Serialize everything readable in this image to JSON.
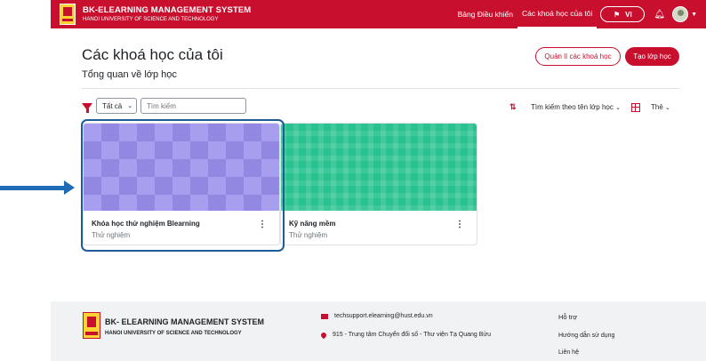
{
  "header": {
    "brand_title": "BK-ELEARNING MANAGEMENT SYSTEM",
    "brand_sub": "HANOI UNIVERSITY OF SCIENCE AND TECHNOLOGY",
    "nav": [
      "Bảng Điều khiển",
      "Các khoá học của tôi"
    ],
    "lang": "VI",
    "colors": {
      "primary": "#c8102e"
    }
  },
  "main": {
    "title": "Các khoá học của tôi",
    "subtitle": "Tổng quan về lớp học",
    "manage_button": "Quản lí các khoá học",
    "create_button": "Tạo lớp học"
  },
  "filters": {
    "select_value": "Tất cả",
    "search_placeholder": "Tìm kiếm",
    "sort_label": "Tìm kiếm theo tên lớp học",
    "view_label": "Thẻ"
  },
  "courses": [
    {
      "name": "Khóa học thử nghiệm Blearning",
      "category": "Thử nghiệm"
    },
    {
      "name": "Kỹ năng mềm",
      "category": "Thử nghiệm"
    }
  ],
  "footer": {
    "brand_title": "BK- ELEARNING MANAGEMENT SYSTEM",
    "brand_sub": "HANOI UNIVERSITY OF SCIENCE AND TECHNOLOGY",
    "email": "techsupport.elearning@hust.edu.vn",
    "address": "915 - Trung tâm Chuyển đổi số - Thư viện Tạ Quang Bửu",
    "support_heading": "Hỗ trợ",
    "links": [
      "Hướng dẫn sử dụng",
      "Liên hệ"
    ]
  }
}
